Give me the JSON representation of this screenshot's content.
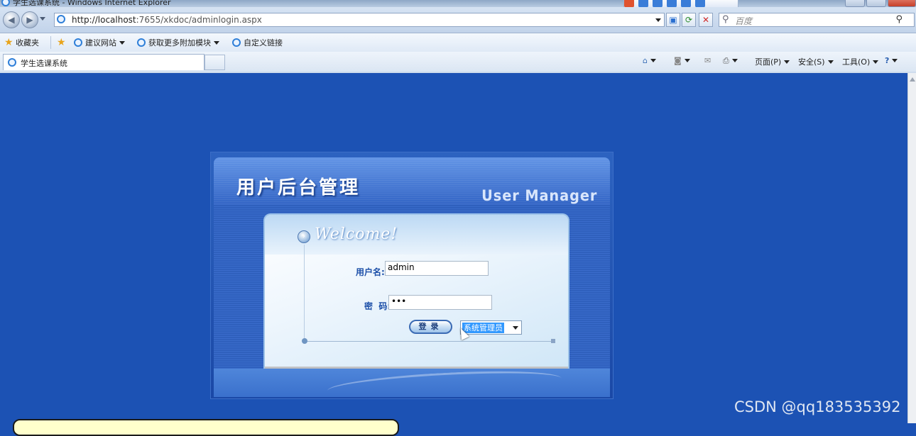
{
  "window": {
    "title": "学生选课系统 - Windows Internet Explorer"
  },
  "address": {
    "url_host": "http://localhost",
    "url_rest": ":7655/xkdoc/adminlogin.aspx",
    "search_placeholder": "百度"
  },
  "favorites": {
    "favorites_label": "收藏夹",
    "items": [
      "建议网站",
      "获取更多附加模块",
      "自定义链接"
    ]
  },
  "tabs": [
    {
      "label": "学生选课系统"
    }
  ],
  "commands": {
    "page": "页面(P)",
    "safety": "安全(S)",
    "tools": "工具(O)"
  },
  "login": {
    "title": "用户后台管理",
    "subtitle": "User Manager",
    "welcome": "Welcome!",
    "username_label": "用户名:",
    "username_value": "admin",
    "password_label": "密  码:",
    "password_value": "•••",
    "login_button": "登录",
    "role_selected": "系统管理员"
  },
  "watermark": "CSDN @qq183535392"
}
